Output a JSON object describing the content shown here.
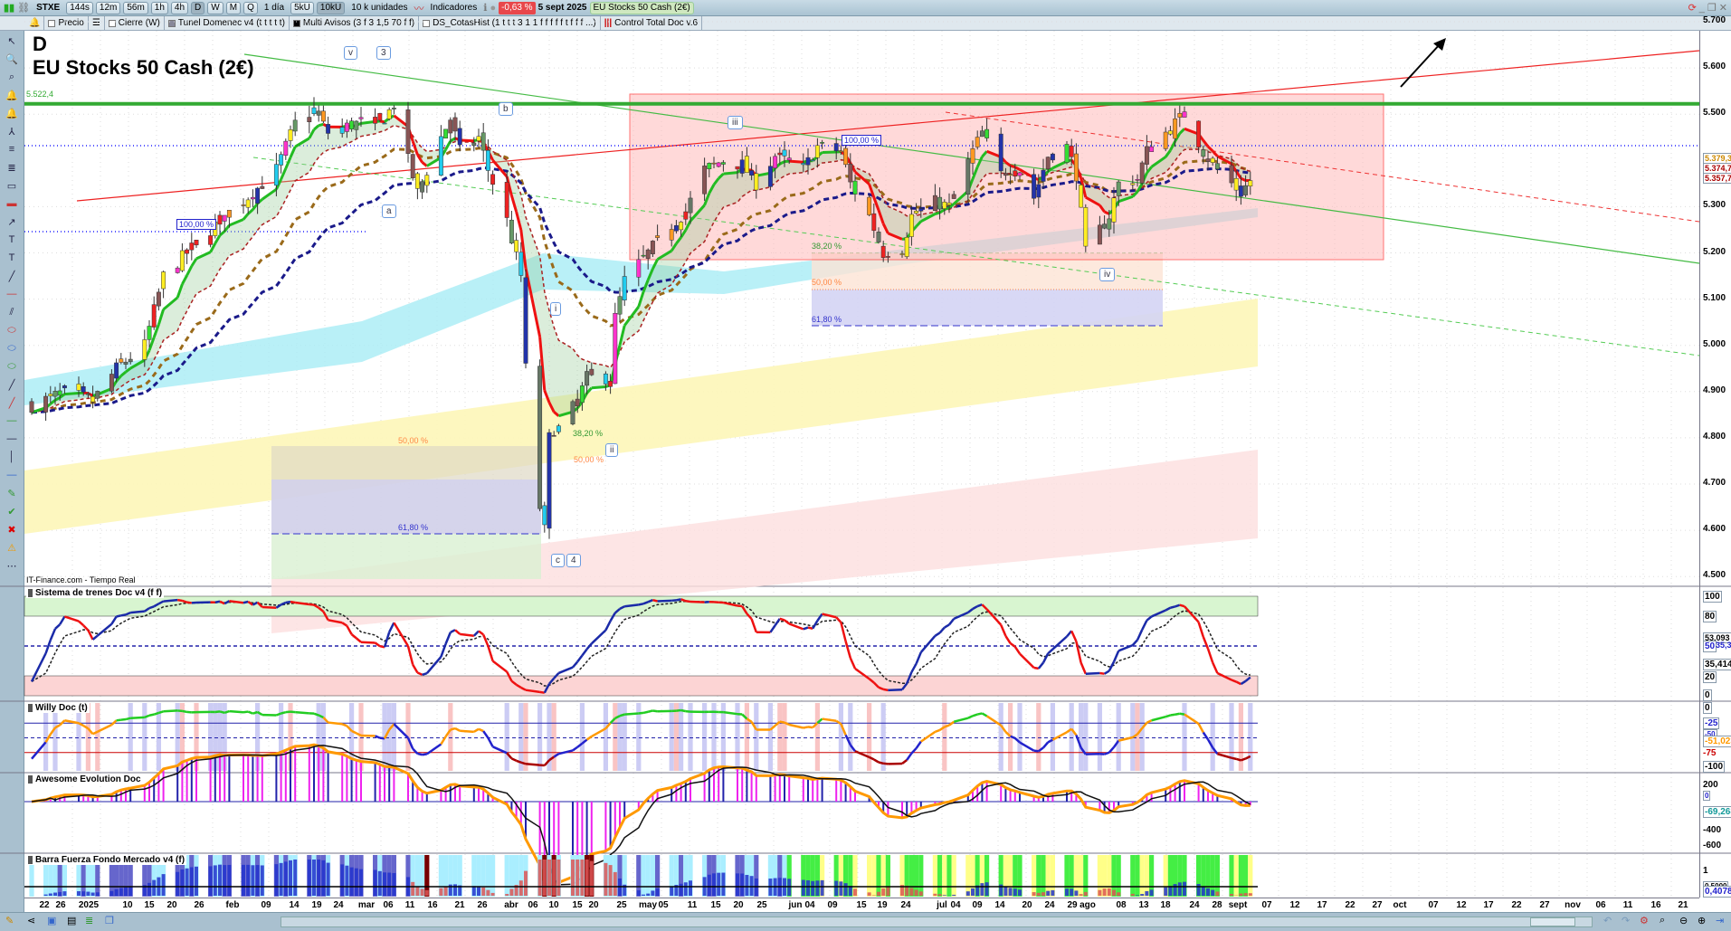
{
  "toolbar": {
    "symbol": "STXE",
    "intervals": [
      "144s",
      "12m",
      "56m",
      "1h",
      "4h",
      "D",
      "W",
      "M",
      "Q"
    ],
    "active_interval": "D",
    "period": "1 día",
    "units_buttons": [
      "5kU",
      "10kU"
    ],
    "units_select": "10 k unidades",
    "indicators": "Indicadores",
    "change": "-0,63 %",
    "date": "5 sept 2025",
    "instrument": "EU Stocks 50 Cash (2€)"
  },
  "indicator_bar": [
    "Precio",
    "Cierre (W)",
    "Tunel Domenec v4 (t t t t t)",
    "Multi Avisos (3 f 3 1,5 70 f f)",
    "DS_CotasHist (1 t t t 3 1 1 f f f f f t f f f ...)",
    "Control Total Doc v.6"
  ],
  "chart": {
    "timeframe": "D",
    "title": "EU Stocks 50 Cash (2€)",
    "source": "IT-Finance.com - Tiempo Real",
    "resistance_label": "5.522,4",
    "resistance": 5522.4,
    "price_ticks": [
      "5.700",
      "5.600",
      "5.500",
      "5.300",
      "5.200",
      "5.100",
      "5.000",
      "4.900",
      "4.800",
      "4.700",
      "4.600",
      "4.500"
    ],
    "price_marks": [
      "5.379,3",
      "5.374,7",
      "5.357,7"
    ],
    "wave_labels": [
      "v",
      "3",
      "b",
      "a",
      "iii",
      "iv",
      "i",
      "ii",
      "c",
      "4"
    ],
    "fib_labels": {
      "f100a": "100,00 %",
      "f100b": "100,00 %",
      "f382a": "38,20 %",
      "f50a": "50,00 %",
      "f618a": "61,80 %",
      "f382b": "38,20 %",
      "f50b": "50,00 %",
      "f50c": "50,00 %",
      "f618b": "61,80 %"
    },
    "price_path": [
      [
        0,
        4870
      ],
      [
        7,
        4900
      ],
      [
        13,
        4880
      ],
      [
        18,
        4950
      ],
      [
        24,
        5000
      ],
      [
        28,
        5150
      ],
      [
        35,
        5220
      ],
      [
        41,
        5280
      ],
      [
        47,
        5330
      ],
      [
        52,
        5380
      ],
      [
        56,
        5480
      ],
      [
        60,
        5510
      ],
      [
        63,
        5460
      ],
      [
        69,
        5480
      ],
      [
        74,
        5480
      ],
      [
        77,
        5520
      ],
      [
        80,
        5400
      ],
      [
        82,
        5330
      ],
      [
        87,
        5450
      ],
      [
        89,
        5490
      ],
      [
        91,
        5420
      ],
      [
        95,
        5450
      ],
      [
        97,
        5380
      ],
      [
        101,
        5270
      ],
      [
        104,
        5150
      ],
      [
        105,
        4950
      ],
      [
        108,
        4650
      ],
      [
        109,
        4600
      ],
      [
        110,
        4800
      ],
      [
        111,
        4820
      ],
      [
        112,
        4820
      ],
      [
        116,
        4880
      ],
      [
        118,
        4930
      ],
      [
        123,
        4930
      ],
      [
        124,
        5060
      ],
      [
        126,
        5140
      ],
      [
        131,
        5200
      ],
      [
        136,
        5260
      ],
      [
        139,
        5290
      ],
      [
        143,
        5380
      ],
      [
        147,
        5400
      ],
      [
        151,
        5390
      ],
      [
        154,
        5350
      ],
      [
        158,
        5410
      ],
      [
        164,
        5380
      ],
      [
        167,
        5430
      ],
      [
        172,
        5420
      ],
      [
        174,
        5350
      ],
      [
        178,
        5280
      ],
      [
        181,
        5200
      ],
      [
        185,
        5210
      ],
      [
        187,
        5280
      ],
      [
        192,
        5310
      ],
      [
        195,
        5300
      ],
      [
        200,
        5420
      ],
      [
        202,
        5460
      ],
      [
        206,
        5370
      ],
      [
        209,
        5390
      ],
      [
        213,
        5320
      ],
      [
        216,
        5410
      ],
      [
        220,
        5430
      ],
      [
        222,
        5370
      ],
      [
        224,
        5200
      ],
      [
        227,
        5250
      ],
      [
        229,
        5280
      ],
      [
        231,
        5350
      ],
      [
        235,
        5360
      ],
      [
        237,
        5420
      ],
      [
        242,
        5470
      ],
      [
        245,
        5500
      ],
      [
        249,
        5420
      ],
      [
        251,
        5390
      ],
      [
        255,
        5350
      ],
      [
        257,
        5330
      ],
      [
        259,
        5357
      ]
    ]
  },
  "panels": [
    {
      "title": "Sistema de trenes Doc v4 (f f)",
      "ticks": [
        "100",
        "80",
        "50",
        "20",
        "0"
      ],
      "values": [
        "53,093",
        "35,312",
        "35,414"
      ]
    },
    {
      "title": "Willy Doc (t)",
      "ticks": [
        "0",
        "-25",
        "-50",
        "-75",
        "-100"
      ],
      "values": [
        "-51,023"
      ]
    },
    {
      "title": "Awesome Evolution Doc",
      "ticks": [
        "200",
        "-400",
        "-600"
      ],
      "values": [
        "0",
        "-69,268"
      ]
    },
    {
      "title": "Barra Fuerza Fondo Mercado v4 (f)",
      "ticks": [
        "1"
      ],
      "values": [
        "0,5000",
        "0,4078"
      ]
    }
  ],
  "dates": [
    [
      "22",
      49
    ],
    [
      "26",
      67
    ],
    [
      "2025",
      98
    ],
    [
      "10",
      141
    ],
    [
      "15",
      165
    ],
    [
      "20",
      190
    ],
    [
      "26",
      220
    ],
    [
      "feb",
      257
    ],
    [
      "09",
      294
    ],
    [
      "14",
      325
    ],
    [
      "19",
      350
    ],
    [
      "24",
      374
    ],
    [
      "mar",
      405
    ],
    [
      "06",
      429
    ],
    [
      "11",
      453
    ],
    [
      "16",
      478
    ],
    [
      "21",
      508
    ],
    [
      "26",
      533
    ],
    [
      "abr",
      565
    ],
    [
      "06",
      589
    ],
    [
      "10",
      612
    ],
    [
      "15",
      638
    ],
    [
      "20",
      656
    ],
    [
      "25",
      687
    ],
    [
      "may",
      716
    ],
    [
      "05",
      733
    ],
    [
      "11",
      765
    ],
    [
      "15",
      791
    ],
    [
      "20",
      816
    ],
    [
      "25",
      842
    ],
    [
      "jun",
      879
    ],
    [
      "04",
      895
    ],
    [
      "09",
      920
    ],
    [
      "15",
      952
    ],
    [
      "19",
      975
    ],
    [
      "24",
      1001
    ],
    [
      "jul",
      1041
    ],
    [
      "04",
      1056
    ],
    [
      "09",
      1080
    ],
    [
      "14",
      1105
    ],
    [
      "20",
      1135
    ],
    [
      "24",
      1160
    ],
    [
      "29",
      1185
    ],
    [
      "ago",
      1202
    ],
    [
      "08",
      1239
    ],
    [
      "13",
      1264
    ],
    [
      "18",
      1288
    ],
    [
      "24",
      1320
    ],
    [
      "28",
      1345
    ],
    [
      "sept",
      1368
    ],
    [
      "07",
      1400
    ],
    [
      "12",
      1431
    ],
    [
      "17",
      1461
    ],
    [
      "22",
      1492
    ],
    [
      "27",
      1522
    ],
    [
      "oct",
      1547
    ],
    [
      "07",
      1584
    ],
    [
      "12",
      1615
    ],
    [
      "17",
      1645
    ],
    [
      "22",
      1676
    ],
    [
      "27",
      1707
    ],
    [
      "nov",
      1738
    ],
    [
      "06",
      1769
    ],
    [
      "11",
      1799
    ],
    [
      "16",
      1830
    ],
    [
      "21",
      1860
    ]
  ],
  "colors": {
    "bull": "#22bb22",
    "bear": "#ee2222",
    "resistance": "#33aa33",
    "box": "#ff0000"
  }
}
